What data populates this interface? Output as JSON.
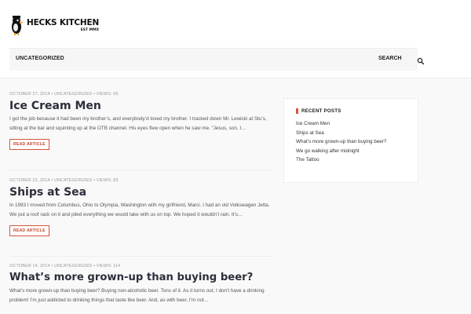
{
  "site": {
    "logo_title": "HECKS KITCHEN",
    "logo_sub": "EST MMX"
  },
  "nav": {
    "category": "UNCATEGORIZED",
    "search_label": "SEARCH",
    "search_icon": "search-icon"
  },
  "posts": [
    {
      "meta": "OCTOBER 27, 2014  •  UNCATEGORIZED  •  VIEWS: 69",
      "title": "Ice Cream Men",
      "excerpt": "I got the job because it had been my brother’s, and everybody’d loved my brother. I tracked down Mr. Lewicki at Stu’s, sitting at the bar and squinting up at the OTB channel. His eyes flew open when he saw me. “Jesus, son, I…",
      "button": "READ ARTICLE"
    },
    {
      "meta": "OCTOBER 22, 2014  •  UNCATEGORIZED  •  VIEWS: 83",
      "title": "Ships at Sea",
      "excerpt": "In 1993 I moved from Columbus, Ohio to Olympia, Washington with my girlfriend, Marci. I had an old Volkswagen Jetta. We put a roof rack on it and piled everything we would take with us on top. We hoped it wouldn’t rain. It’s…",
      "button": "READ ARTICLE"
    },
    {
      "meta": "OCTOBER 14, 2014  •  UNCATEGORIZED  •  VIEWS: 114",
      "title": "What’s more grown-up than buying beer?",
      "excerpt": "What’s more grown-up than buying beer? Buying non-alcoholic beer. Tons of it. As it turns out, I don’t have a drinking problem! I’m just addicted to drinking things that taste like beer. And, as with beer, I’m not…",
      "button": "READ ARTICLE"
    }
  ],
  "sidebar": {
    "widget_title": "RECENT POSTS",
    "accent": "#d5553e",
    "items": [
      "Ice Cream Men",
      "Ships at Sea",
      "What’s more grown-up than buying beer?",
      "We go walking after midnight",
      "The Tattoo"
    ]
  }
}
